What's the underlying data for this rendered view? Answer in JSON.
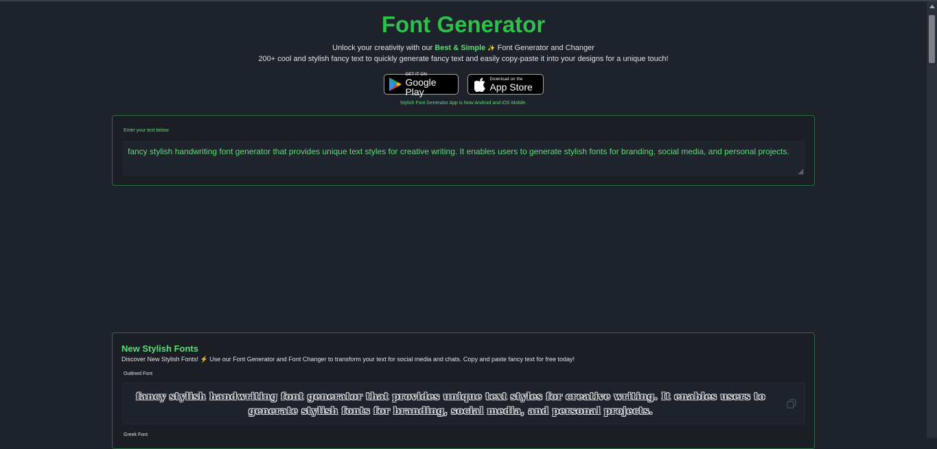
{
  "header": {
    "title": "Font Generator",
    "sub1_pre": "Unlock your creativity with our ",
    "sub1_highlight": "Best & Simple",
    "sub1_spark": "✨",
    "sub1_post": " Font Generator and Changer",
    "sub2": "200+ cool and stylish fancy text to quickly generate fancy text and easily copy-paste it into your designs for a unique touch!"
  },
  "stores": {
    "google_small": "GET IT ON",
    "google_big": "Google Play",
    "apple_small": "Download on the",
    "apple_big": "App Store",
    "note": "Stylish Font Generator App is Now Android and iOS Mobile."
  },
  "input": {
    "label": "Enter your text below",
    "value": "fancy stylish handwriting font generator that provides unique text styles for creative writing. It enables users to generate stylish fonts for branding, social media, and personal projects."
  },
  "fonts_section": {
    "title": "New Stylish Fonts",
    "desc_pre": "Discover New Stylish Fonts! ",
    "desc_bolt": "⚡",
    "desc_post": " Use our Font Generator and Font Changer to transform your text for social media and chats. Copy and paste fancy text for free today!",
    "items": [
      {
        "label": "Outlined Font",
        "sample": "fancy stylish handwriting font generator that provides unique text styles for creative writing. It enables users to generate stylish fonts for branding, social media, and personal projects."
      },
      {
        "label": "Greek Font"
      }
    ]
  },
  "colors": {
    "background": "#1e222b",
    "accent_green": "#2fbf4d",
    "light_green": "#5fdc7a",
    "card_border": "#2f6d42"
  },
  "icons": [
    "play-store-icon",
    "apple-icon",
    "copy-icon"
  ]
}
